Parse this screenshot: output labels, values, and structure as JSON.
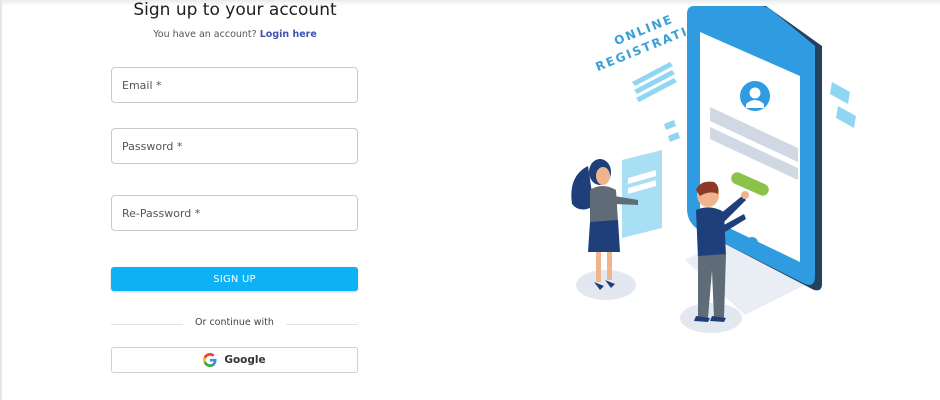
{
  "form": {
    "title": "Sign up to your account",
    "subtitle_prefix": "You have an account?",
    "login_link": "Login here",
    "email_placeholder": "Email *",
    "password_placeholder": "Password *",
    "repassword_placeholder": "Re-Password *",
    "signup_label": "SIGN UP",
    "divider_text": "Or continue with",
    "google_label": "Google"
  },
  "illustration": {
    "line1": "ONLINE",
    "line2": "REGISTRATION"
  },
  "colors": {
    "accent": "#0db1f5",
    "link": "#3f51b5",
    "phone_frame": "#2f9be0",
    "phone_dark": "#23415e"
  }
}
